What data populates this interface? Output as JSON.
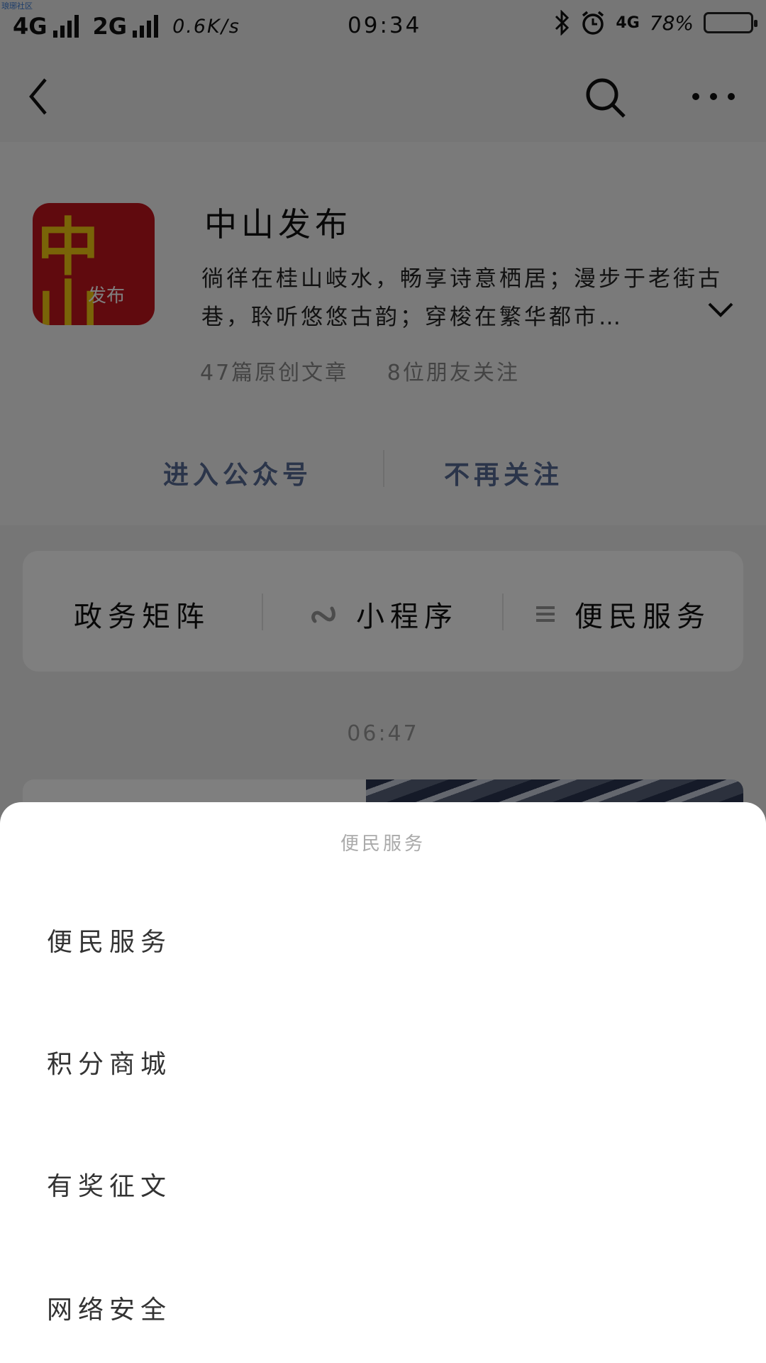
{
  "status_bar": {
    "watermark": "琅琊社区",
    "network1": "4G",
    "network2": "2G",
    "speed": "0.6K/s",
    "time": "09:34",
    "network3": "4G",
    "battery": "78%",
    "battery_level": 0.78,
    "icons": [
      "bluetooth-icon",
      "alarm-icon",
      "signal-bars-icon",
      "battery-icon"
    ]
  },
  "navbar": {
    "icons": [
      "back-icon",
      "search-icon",
      "more-icon"
    ]
  },
  "profile": {
    "avatar_text_big": "中山",
    "avatar_text_small": "发布",
    "name": "中山发布",
    "description": "徜徉在桂山岐水，畅享诗意栖居；漫步于老街古巷，聆听悠悠古韵；穿梭在繁华都市…",
    "stats_articles": "47篇原创文章",
    "stats_friends": "8位朋友关注",
    "enter_label": "进入公众号",
    "unfollow_label": "不再关注"
  },
  "menu": {
    "item1": "政务矩阵",
    "item2": "小程序",
    "item3": "便民服务",
    "icons": [
      "mini-program-icon",
      "list-icon"
    ]
  },
  "feed": {
    "timestamp": "06:47"
  },
  "sheet": {
    "title": "便民服务",
    "items": [
      "便民服务",
      "积分商城",
      "有奖征文",
      "网络安全"
    ]
  }
}
